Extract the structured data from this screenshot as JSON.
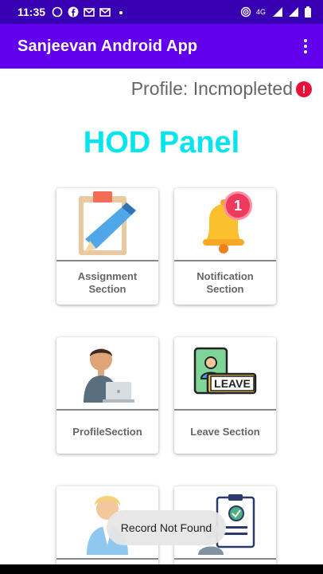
{
  "status_bar": {
    "time": "11:35",
    "network": "4G",
    "notification_icons": [
      "whatsapp-icon",
      "facebook-icon",
      "gmail-icon",
      "gmail-icon",
      "dot-icon"
    ],
    "right_icons": [
      "hotspot-icon",
      "data-icon",
      "wifi-signal-icon",
      "cell-signal-icon",
      "battery-icon"
    ]
  },
  "app_bar": {
    "title": "Sanjeevan Android App",
    "menu_icon": "overflow-menu-icon",
    "color": "#6200ee"
  },
  "profile": {
    "status_text": "Profile: Incmopleted",
    "alert_symbol": "!",
    "alert_color": "#e8113a"
  },
  "panel": {
    "title": "HOD Panel",
    "title_color": "#00e5ee"
  },
  "cards": [
    {
      "id": "assignment",
      "label": "Assignment Section",
      "icon": "assignment-clipboard-icon"
    },
    {
      "id": "notification",
      "label": "Notification Section",
      "icon": "notification-bell-icon",
      "badge": "1"
    },
    {
      "id": "profile",
      "label": "ProfileSection",
      "icon": "person-laptop-icon"
    },
    {
      "id": "leave",
      "label": "Leave Section",
      "icon": "leave-icon",
      "leave_text": "LEAVE"
    },
    {
      "id": "staff",
      "label": "",
      "icon": "staff-person-icon"
    },
    {
      "id": "report",
      "label": "",
      "icon": "report-clipboard-icon"
    }
  ],
  "toast": {
    "text": "Record Not Found"
  }
}
